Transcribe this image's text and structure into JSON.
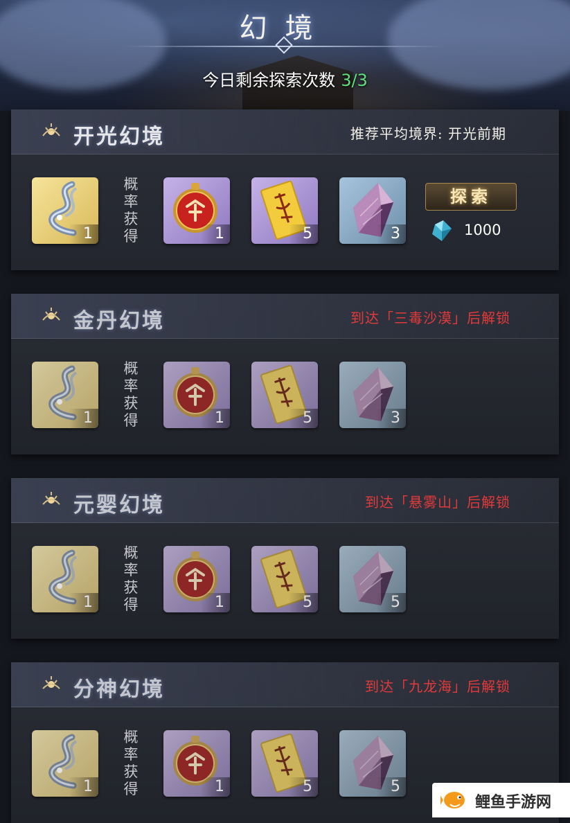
{
  "header": {
    "title": "幻境",
    "explore_label": "今日剩余探索次数",
    "explore_count": "3/3"
  },
  "realms": [
    {
      "name": "开光幻境",
      "status_text": "推荐平均境界: 开光前期",
      "locked": false,
      "prob_label": [
        "概",
        "率",
        "获",
        "得"
      ],
      "rewards": [
        {
          "icon": "silk-ribbon-icon",
          "qty": "1",
          "rarity": "gold"
        },
        {
          "icon": "red-medallion-icon",
          "qty": "1",
          "rarity": "purple"
        },
        {
          "icon": "yellow-talisman-icon",
          "qty": "5",
          "rarity": "purple"
        },
        {
          "icon": "purple-crystal-icon",
          "qty": "3",
          "rarity": "blue"
        }
      ],
      "explore_button": "探索",
      "cost": "1000"
    },
    {
      "name": "金丹幻境",
      "status_text": "到达「三毒沙漠」后解锁",
      "locked": true,
      "prob_label": [
        "概",
        "率",
        "获",
        "得"
      ],
      "rewards": [
        {
          "icon": "silk-ribbon-icon",
          "qty": "1",
          "rarity": "gold"
        },
        {
          "icon": "red-medallion-icon",
          "qty": "1",
          "rarity": "purple"
        },
        {
          "icon": "yellow-talisman-icon",
          "qty": "5",
          "rarity": "purple"
        },
        {
          "icon": "purple-crystal-icon",
          "qty": "3",
          "rarity": "blue"
        }
      ]
    },
    {
      "name": "元婴幻境",
      "status_text": "到达「悬雾山」后解锁",
      "locked": true,
      "prob_label": [
        "概",
        "率",
        "获",
        "得"
      ],
      "rewards": [
        {
          "icon": "silk-ribbon-icon",
          "qty": "1",
          "rarity": "gold"
        },
        {
          "icon": "red-medallion-icon",
          "qty": "1",
          "rarity": "purple"
        },
        {
          "icon": "yellow-talisman-icon",
          "qty": "5",
          "rarity": "purple"
        },
        {
          "icon": "purple-crystal-icon",
          "qty": "5",
          "rarity": "blue"
        }
      ]
    },
    {
      "name": "分神幻境",
      "status_text": "到达「九龙海」后解锁",
      "locked": true,
      "prob_label": [
        "概",
        "率",
        "获",
        "得"
      ],
      "rewards": [
        {
          "icon": "silk-ribbon-icon",
          "qty": "1",
          "rarity": "gold"
        },
        {
          "icon": "red-medallion-icon",
          "qty": "1",
          "rarity": "purple"
        },
        {
          "icon": "yellow-talisman-icon",
          "qty": "5",
          "rarity": "purple"
        },
        {
          "icon": "purple-crystal-icon",
          "qty": "5",
          "rarity": "blue"
        }
      ]
    }
  ],
  "watermark": {
    "text": "鲤鱼手游网"
  },
  "colors": {
    "count": "#5fe07a",
    "locked_text": "#e23a3a",
    "button_gold": "#f8e7b8"
  }
}
